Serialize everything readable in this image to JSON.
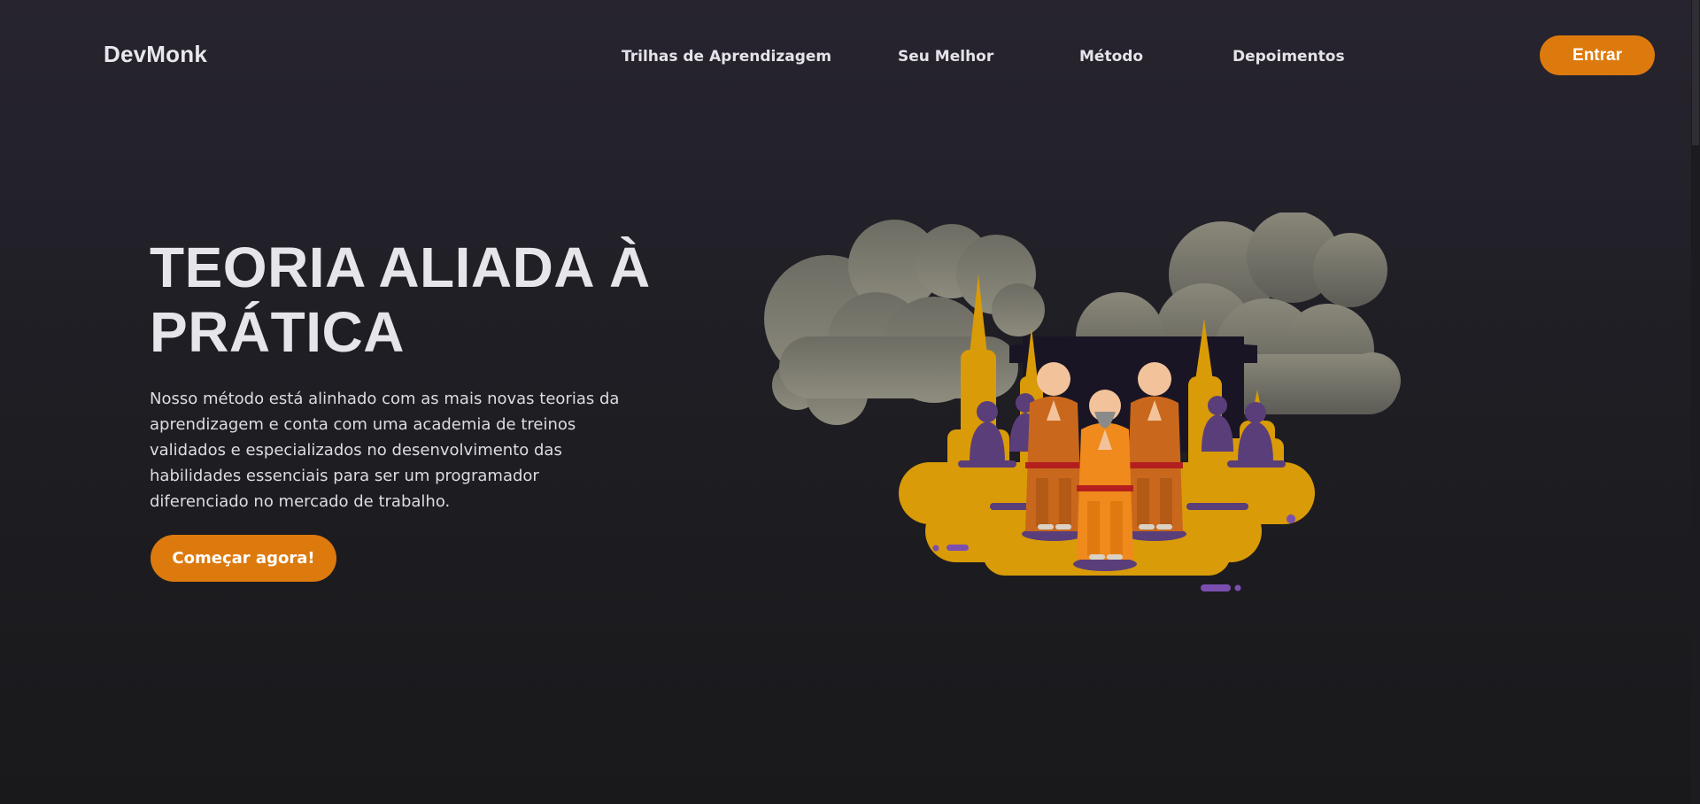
{
  "navbar": {
    "logo": "DevMonk",
    "links": [
      "Trilhas de Aprendizagem",
      "Seu Melhor",
      "Método",
      "Depoimentos"
    ],
    "login_label": "Entrar"
  },
  "hero": {
    "title": "TEORIA ALIADA À PRÁTICA",
    "description": "Nosso método está alinhado com as mais novas teorias da aprendizagem e conta com uma academia de treinos validados e especializados no desenvolvimento das habilidades essenciais para ser um programador diferenciado no mercado de trabalho.",
    "cta_label": "Começar agora!"
  },
  "colors": {
    "accent": "#dd7a0e",
    "background": "#1f1e24",
    "temple_gold": "#d99b07",
    "robe_orange": "#f08a1c",
    "silhouette_purple": "#5a3e7a"
  },
  "icons": {
    "illustration": "monks-temple-illustration"
  }
}
